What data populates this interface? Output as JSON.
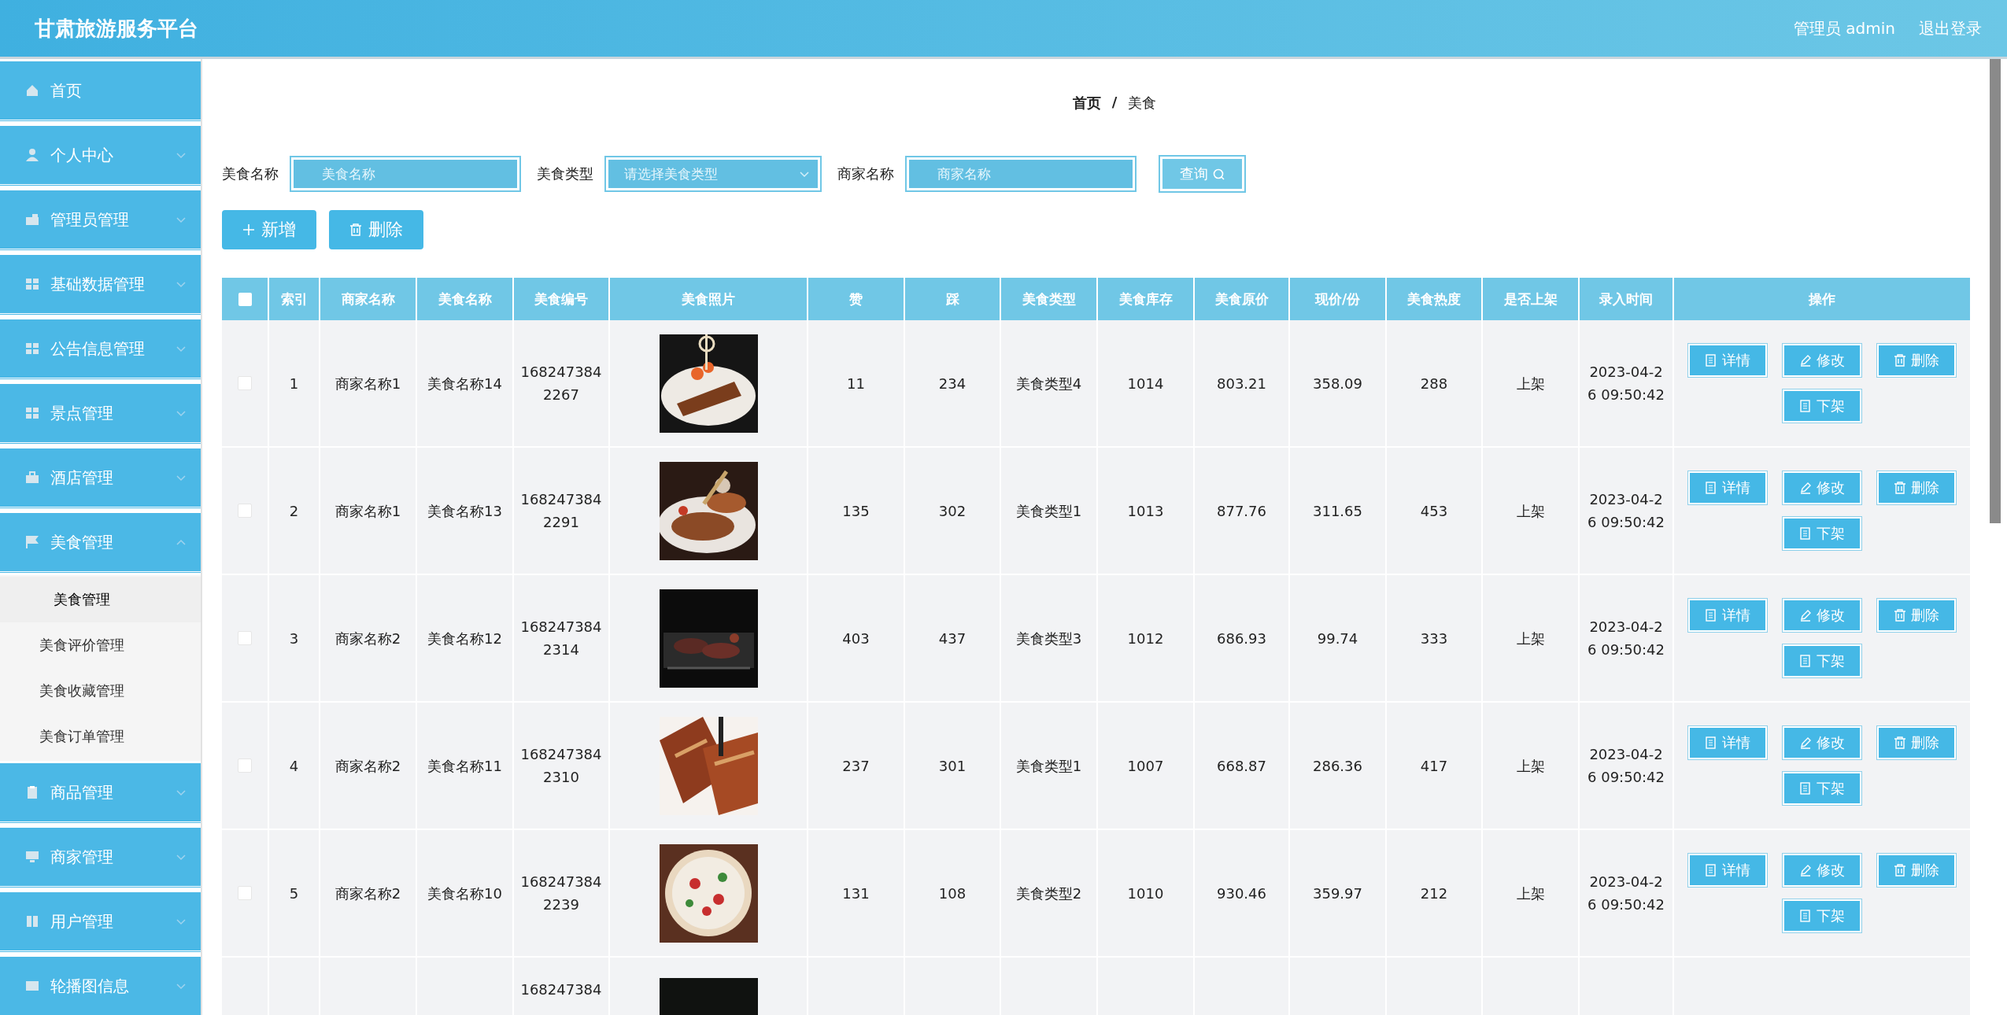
{
  "header": {
    "title": "甘肃旅游服务平台",
    "user": "管理员 admin",
    "logout": "退出登录"
  },
  "sidebar": {
    "items": [
      {
        "label": "首页",
        "kind": "link"
      },
      {
        "label": "个人中心",
        "kind": "group",
        "expanded": false
      },
      {
        "label": "管理员管理",
        "kind": "group",
        "expanded": false
      },
      {
        "label": "基础数据管理",
        "kind": "group",
        "expanded": false
      },
      {
        "label": "公告信息管理",
        "kind": "group",
        "expanded": false
      },
      {
        "label": "景点管理",
        "kind": "group",
        "expanded": false
      },
      {
        "label": "酒店管理",
        "kind": "group",
        "expanded": false
      },
      {
        "label": "美食管理",
        "kind": "group",
        "expanded": true,
        "children": [
          {
            "label": "美食管理",
            "selected": true
          },
          {
            "label": "美食评价管理",
            "selected": false
          },
          {
            "label": "美食收藏管理",
            "selected": false
          },
          {
            "label": "美食订单管理",
            "selected": false
          }
        ]
      },
      {
        "label": "商品管理",
        "kind": "group",
        "expanded": false
      },
      {
        "label": "商家管理",
        "kind": "group",
        "expanded": false
      },
      {
        "label": "用户管理",
        "kind": "group",
        "expanded": false
      },
      {
        "label": "轮播图信息",
        "kind": "group",
        "expanded": false
      }
    ]
  },
  "breadcrumb": {
    "items": [
      "首页",
      "美食"
    ],
    "separator": "/"
  },
  "search": {
    "fields": [
      {
        "label": "美食名称",
        "placeholder": "美食名称",
        "kind": "input"
      },
      {
        "label": "美食类型",
        "placeholder": "请选择美食类型",
        "kind": "select"
      },
      {
        "label": "商家名称",
        "placeholder": "商家名称",
        "kind": "input"
      }
    ],
    "button": "查询"
  },
  "actions": [
    "新增",
    "删除"
  ],
  "table": {
    "select_all": {
      "checked": false
    },
    "columns": [
      "索引",
      "商家名称",
      "美食名称",
      "美食编号",
      "美食照片",
      "赞",
      "踩",
      "美食类型",
      "美食库存",
      "美食原价",
      "现价/份",
      "美食热度",
      "是否上架",
      "录入时间",
      "操作"
    ],
    "rows": [
      {
        "kind": "full",
        "checked": false,
        "cells": [
          "1",
          "商家名称1",
          "美食名称14",
          "1682473842267",
          null,
          "11",
          "234",
          "美食类型4",
          "1014",
          "803.21",
          "358.09",
          "288",
          "上架",
          "2023-04-26 09:50:42"
        ],
        "actions": [
          "详情",
          "修改",
          "删除",
          "下架"
        ]
      },
      {
        "kind": "full",
        "checked": false,
        "cells": [
          "2",
          "商家名称1",
          "美食名称13",
          "1682473842291",
          null,
          "135",
          "302",
          "美食类型1",
          "1013",
          "877.76",
          "311.65",
          "453",
          "上架",
          "2023-04-26 09:50:42"
        ],
        "actions": [
          "详情",
          "修改",
          "删除",
          "下架"
        ]
      },
      {
        "kind": "full",
        "checked": false,
        "cells": [
          "3",
          "商家名称2",
          "美食名称12",
          "1682473842314",
          null,
          "403",
          "437",
          "美食类型3",
          "1012",
          "686.93",
          "99.74",
          "333",
          "上架",
          "2023-04-26 09:50:42"
        ],
        "actions": [
          "详情",
          "修改",
          "删除",
          "下架"
        ]
      },
      {
        "kind": "full",
        "checked": false,
        "cells": [
          "4",
          "商家名称2",
          "美食名称11",
          "1682473842310",
          null,
          "237",
          "301",
          "美食类型1",
          "1007",
          "668.87",
          "286.36",
          "417",
          "上架",
          "2023-04-26 09:50:42"
        ],
        "actions": [
          "详情",
          "修改",
          "删除",
          "下架"
        ]
      },
      {
        "kind": "full",
        "checked": false,
        "cells": [
          "5",
          "商家名称2",
          "美食名称10",
          "1682473842239",
          null,
          "131",
          "108",
          "美食类型2",
          "1010",
          "930.46",
          "359.97",
          "212",
          "上架",
          "2023-04-26 09:50:42"
        ],
        "actions": [
          "详情",
          "修改",
          "删除",
          "下架"
        ]
      },
      {
        "kind": "partial",
        "cells": [
          null,
          null,
          null,
          "168247384",
          null,
          null,
          null,
          null,
          null,
          null,
          null,
          null,
          null,
          null
        ]
      }
    ]
  }
}
